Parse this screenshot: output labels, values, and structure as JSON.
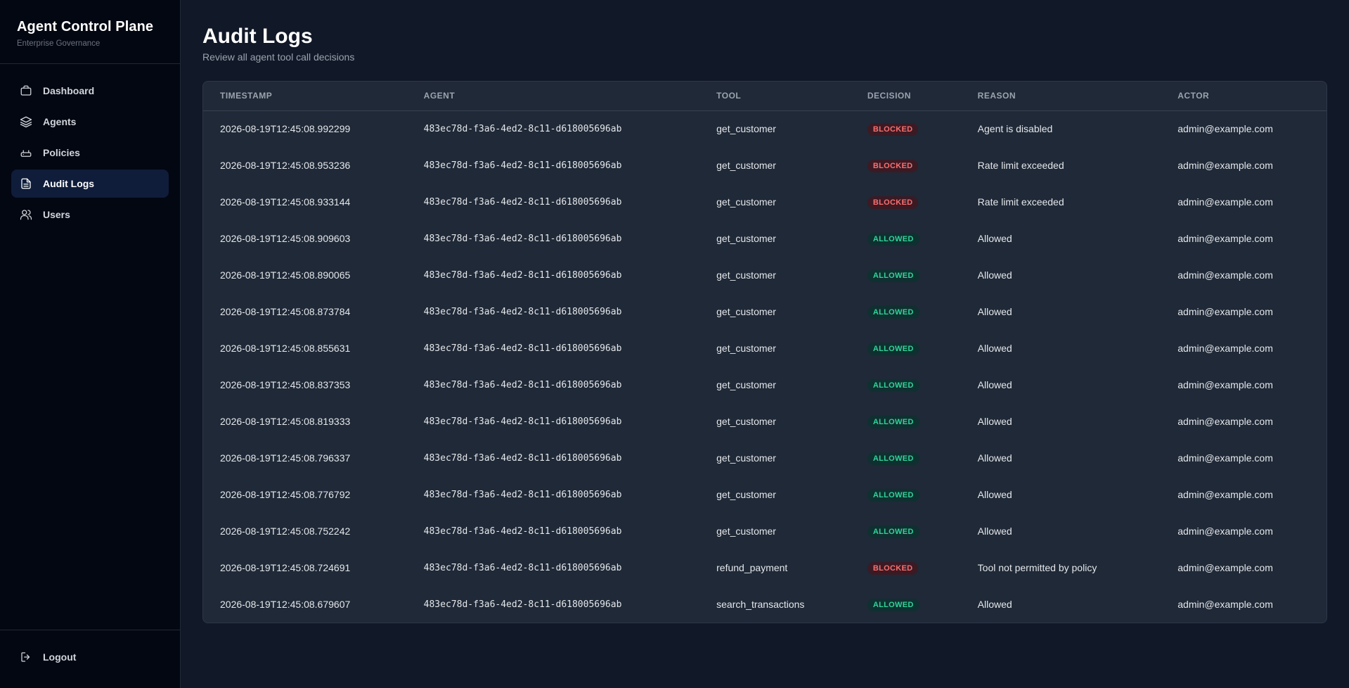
{
  "sidebar": {
    "title": "Agent Control Plane",
    "subtitle": "Enterprise Governance",
    "items": [
      {
        "label": "Dashboard",
        "icon": "briefcase-icon"
      },
      {
        "label": "Agents",
        "icon": "layers-icon"
      },
      {
        "label": "Policies",
        "icon": "router-icon"
      },
      {
        "label": "Audit Logs",
        "icon": "file-text-icon",
        "active": true
      },
      {
        "label": "Users",
        "icon": "users-icon"
      }
    ],
    "logout_label": "Logout"
  },
  "main": {
    "title": "Audit Logs",
    "subtitle": "Review all agent tool call decisions"
  },
  "table": {
    "headers": [
      "TIMESTAMP",
      "AGENT",
      "TOOL",
      "DECISION",
      "REASON",
      "ACTOR"
    ],
    "rows": [
      {
        "timestamp": "2026-08-19T12:45:08.992299",
        "agent": "483ec78d-f3a6-4ed2-8c11-d618005696ab",
        "tool": "get_customer",
        "decision": "BLOCKED",
        "reason": "Agent is disabled",
        "actor": "admin@example.com"
      },
      {
        "timestamp": "2026-08-19T12:45:08.953236",
        "agent": "483ec78d-f3a6-4ed2-8c11-d618005696ab",
        "tool": "get_customer",
        "decision": "BLOCKED",
        "reason": "Rate limit exceeded",
        "actor": "admin@example.com"
      },
      {
        "timestamp": "2026-08-19T12:45:08.933144",
        "agent": "483ec78d-f3a6-4ed2-8c11-d618005696ab",
        "tool": "get_customer",
        "decision": "BLOCKED",
        "reason": "Rate limit exceeded",
        "actor": "admin@example.com"
      },
      {
        "timestamp": "2026-08-19T12:45:08.909603",
        "agent": "483ec78d-f3a6-4ed2-8c11-d618005696ab",
        "tool": "get_customer",
        "decision": "ALLOWED",
        "reason": "Allowed",
        "actor": "admin@example.com"
      },
      {
        "timestamp": "2026-08-19T12:45:08.890065",
        "agent": "483ec78d-f3a6-4ed2-8c11-d618005696ab",
        "tool": "get_customer",
        "decision": "ALLOWED",
        "reason": "Allowed",
        "actor": "admin@example.com"
      },
      {
        "timestamp": "2026-08-19T12:45:08.873784",
        "agent": "483ec78d-f3a6-4ed2-8c11-d618005696ab",
        "tool": "get_customer",
        "decision": "ALLOWED",
        "reason": "Allowed",
        "actor": "admin@example.com"
      },
      {
        "timestamp": "2026-08-19T12:45:08.855631",
        "agent": "483ec78d-f3a6-4ed2-8c11-d618005696ab",
        "tool": "get_customer",
        "decision": "ALLOWED",
        "reason": "Allowed",
        "actor": "admin@example.com"
      },
      {
        "timestamp": "2026-08-19T12:45:08.837353",
        "agent": "483ec78d-f3a6-4ed2-8c11-d618005696ab",
        "tool": "get_customer",
        "decision": "ALLOWED",
        "reason": "Allowed",
        "actor": "admin@example.com"
      },
      {
        "timestamp": "2026-08-19T12:45:08.819333",
        "agent": "483ec78d-f3a6-4ed2-8c11-d618005696ab",
        "tool": "get_customer",
        "decision": "ALLOWED",
        "reason": "Allowed",
        "actor": "admin@example.com"
      },
      {
        "timestamp": "2026-08-19T12:45:08.796337",
        "agent": "483ec78d-f3a6-4ed2-8c11-d618005696ab",
        "tool": "get_customer",
        "decision": "ALLOWED",
        "reason": "Allowed",
        "actor": "admin@example.com"
      },
      {
        "timestamp": "2026-08-19T12:45:08.776792",
        "agent": "483ec78d-f3a6-4ed2-8c11-d618005696ab",
        "tool": "get_customer",
        "decision": "ALLOWED",
        "reason": "Allowed",
        "actor": "admin@example.com"
      },
      {
        "timestamp": "2026-08-19T12:45:08.752242",
        "agent": "483ec78d-f3a6-4ed2-8c11-d618005696ab",
        "tool": "get_customer",
        "decision": "ALLOWED",
        "reason": "Allowed",
        "actor": "admin@example.com"
      },
      {
        "timestamp": "2026-08-19T12:45:08.724691",
        "agent": "483ec78d-f3a6-4ed2-8c11-d618005696ab",
        "tool": "refund_payment",
        "decision": "BLOCKED",
        "reason": "Tool not permitted by policy",
        "actor": "admin@example.com"
      },
      {
        "timestamp": "2026-08-19T12:45:08.679607",
        "agent": "483ec78d-f3a6-4ed2-8c11-d618005696ab",
        "tool": "search_transactions",
        "decision": "ALLOWED",
        "reason": "Allowed",
        "actor": "admin@example.com"
      }
    ]
  },
  "colors": {
    "background": "#111827",
    "sidebar": "#030712",
    "card": "#1f2937",
    "active_nav": "#0f1d3a",
    "blocked": "#f87171",
    "allowed": "#34d399"
  }
}
